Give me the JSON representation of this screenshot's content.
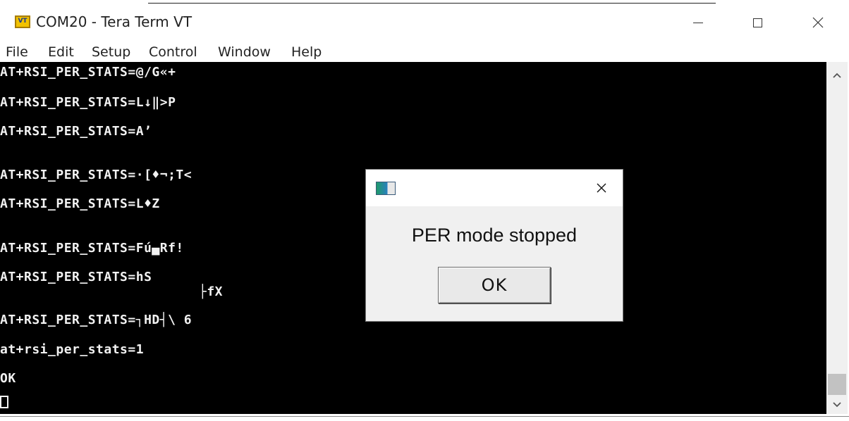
{
  "window": {
    "title": "COM20 - Tera Term VT",
    "icon_text": "VT"
  },
  "menu": {
    "items": [
      "File",
      "Edit",
      "Setup",
      "Control",
      "Window",
      "Help"
    ]
  },
  "terminal": {
    "lines": [
      "AT+RSI_PER_STATS=@/G«+",
      "AT+RSI_PER_STATS=L↓‖>P",
      "AT+RSI_PER_STATS=A’",
      "AT+RSI_PER_STATS=·[♦¬;T<",
      "AT+RSI_PER_STATS=L♦Z",
      "AT+RSI_PER_STATS=Fú▄Rf!",
      "AT+RSI_PER_STATS=hS",
      "├fX",
      "AT+RSI_PER_STATS=┐HD┤\\ 6",
      "at+rsi_per_stats=1",
      "OK"
    ]
  },
  "dialog": {
    "message": "PER mode stopped",
    "ok_label": "OK"
  },
  "colors": {
    "terminal_background": "#000000",
    "terminal_text": "#f2f2f2",
    "dialog_background": "#f0f0f0"
  },
  "icons": {
    "app": "tera-term-icon",
    "minimize": "minimize-icon",
    "maximize": "maximize-icon",
    "close": "close-icon",
    "dialog": "dialog-app-icon",
    "dialog_close": "close-icon",
    "scroll_up": "chevron-up-icon",
    "scroll_down": "chevron-down-icon"
  }
}
